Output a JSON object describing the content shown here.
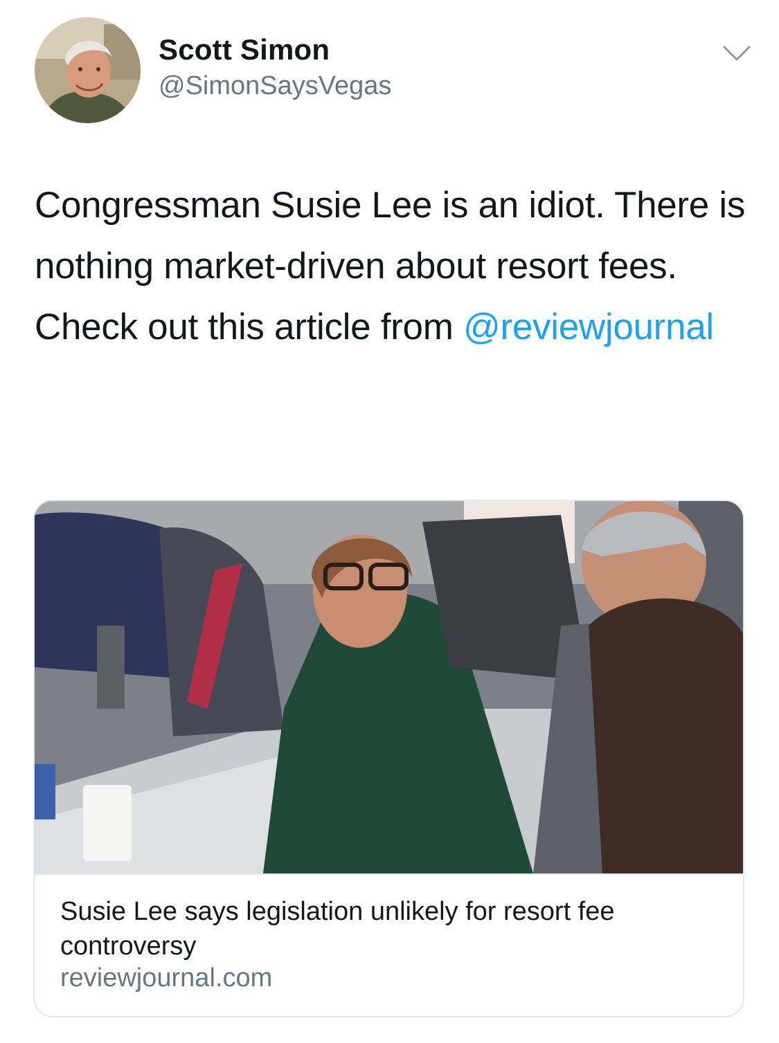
{
  "tweet": {
    "author": {
      "display_name": "Scott Simon",
      "handle": "@SimonSaysVegas",
      "avatar_icon": "profile-photo"
    },
    "menu_icon": "chevron-down-icon",
    "text_main": "Congressman Susie Lee is an idiot. There is nothing market-driven about resort fees. Check out this article from",
    "mention": "@reviewjournal"
  },
  "card": {
    "image_description_icon": "article-photo",
    "title": "Susie Lee says legislation unlikely for resort fee controversy",
    "domain": "reviewjournal.com"
  },
  "colors": {
    "text": "#14171a",
    "secondary": "#657786",
    "link": "#1da1f2",
    "border": "#e1e8ed"
  }
}
